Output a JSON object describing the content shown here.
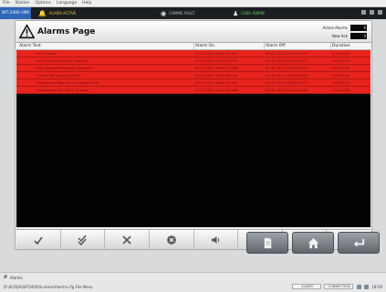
{
  "menubar": {
    "items": [
      "File",
      "Station",
      "Options",
      "Language",
      "Help"
    ]
  },
  "statusbar": {
    "app_label": "WT-2400 HMI",
    "alarm_text": "ALARM ACTIVE",
    "comm_text": "COMMS FAULT",
    "user_text": "USER ADMIN"
  },
  "header": {
    "title": "Alarms Page",
    "active_label": "Active Alarms",
    "active_value": "6",
    "new_label": "New Ack",
    "new_value": "0"
  },
  "table": {
    "columns": [
      "Alarm Text",
      "Alarm On",
      "Alarm Off",
      "Duration"
    ],
    "rows": [
      {
        "text": "VCB Tripped",
        "on": "05-02-2024 18:59:09:377",
        "off": "05-02-2024 18:59:09:377",
        "duration": "0.00:00:00"
      },
      {
        "text": "Earth Fault Protection Operated",
        "on": "05-02-2024 18:59:07:293",
        "off": "05-02-2024 18:59:09:377",
        "duration": "0.00:00:02"
      },
      {
        "text": "Over Current Protection Operated",
        "on": "05-02-2024 18:59:07:288",
        "off": "05-02-2024 18:59:09:377",
        "duration": "0.00:00:02"
      },
      {
        "text": "Turbine Temperature Alarm",
        "on": "05-02-2024 18:59:06:940",
        "off": "05-02-2024 18:59:06:940",
        "duration": "0.00:00:00"
      },
      {
        "text": "Transformer Main Tank Pressure Relief",
        "on": "05-02-2024 18:49:42:580",
        "off": "05-02-2024 18:59:09:377",
        "duration": "0.00:09:27"
      },
      {
        "text": "Transformer Main Tank Oil Level",
        "on": "05-02-2024 18:49:42:568",
        "off": "05-02-2024 18:49:43:000",
        "duration": "0.00:00:00"
      }
    ]
  },
  "toolbar": {
    "buttons": [
      {
        "icon": "acknowledge-icon"
      },
      {
        "icon": "acknowledge-all-icon"
      },
      {
        "icon": "clear-icon"
      },
      {
        "icon": "reset-icon"
      },
      {
        "icon": "silence-horn-icon"
      },
      {
        "icon": "comment-icon"
      },
      {
        "icon": "history-icon"
      },
      {
        "icon": "export-icon"
      }
    ]
  },
  "nav": {
    "buttons": [
      {
        "icon": "page-icon"
      },
      {
        "icon": "home-icon"
      },
      {
        "icon": "return-icon"
      }
    ]
  },
  "taskbar": {
    "tab_label": "Alarms",
    "file_path": "D:\\SCADA\\WT2400\\Screens\\Alarms.cfg  File Menu",
    "field1": "ALARM",
    "field2": "CONNECTION",
    "clock": "18:59"
  },
  "colors": {
    "alarm_row": "#e8231d",
    "alarm_row_text": "#6f0d09",
    "table_bg": "#020202",
    "status_bar": "#1c1f22"
  }
}
